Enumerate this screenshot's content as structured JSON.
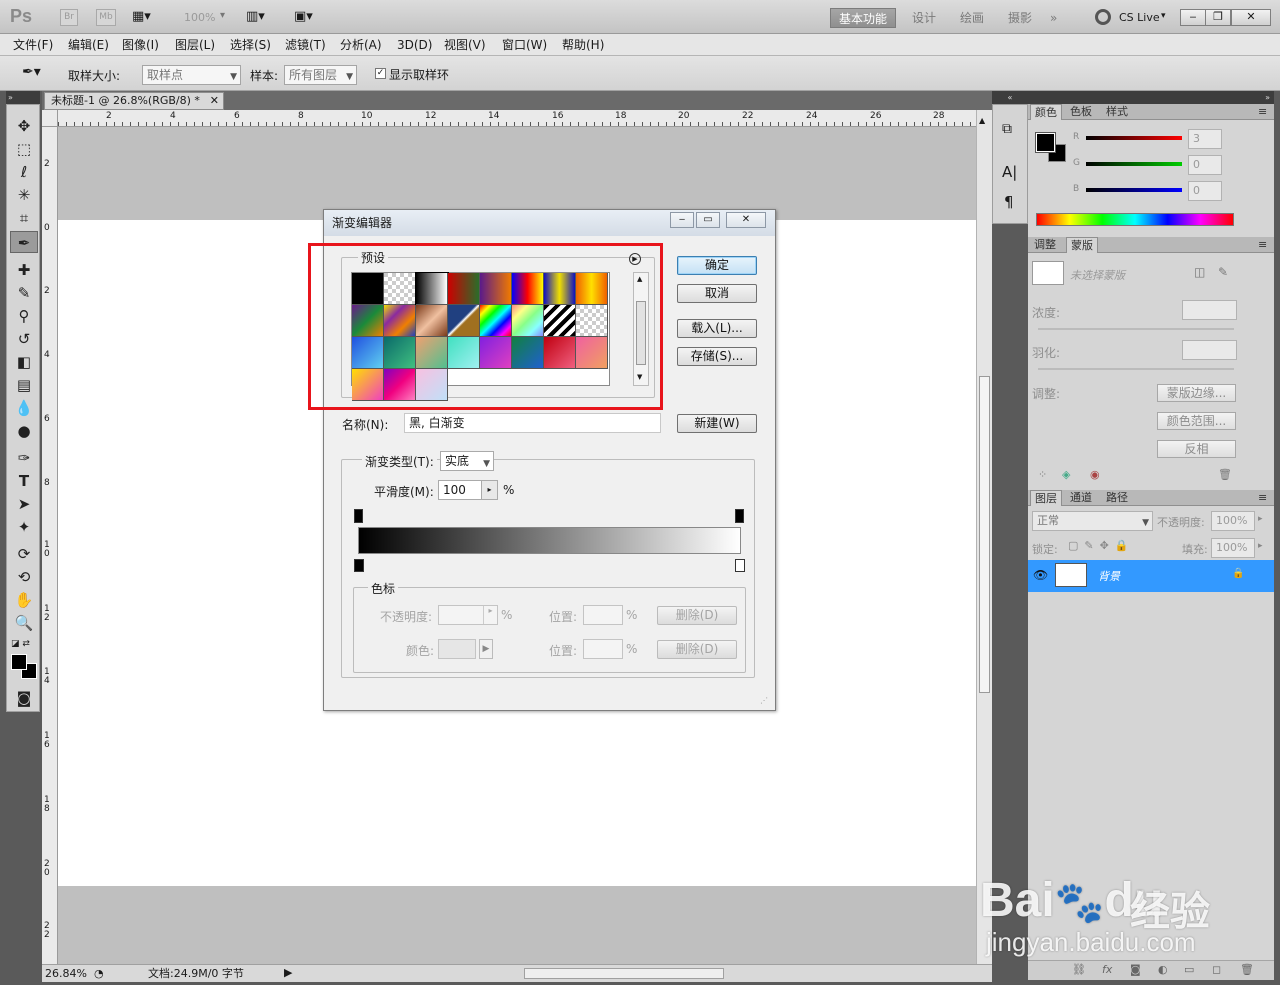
{
  "app": {
    "logo": "Ps",
    "br": "Br",
    "mb": "Mb",
    "zoom": "100%",
    "workspaces": [
      "基本功能",
      "设计",
      "绘画",
      "摄影",
      "»"
    ],
    "cs_live": "CS Live"
  },
  "menu": [
    "文件(F)",
    "编辑(E)",
    "图像(I)",
    "图层(L)",
    "选择(S)",
    "滤镜(T)",
    "分析(A)",
    "3D(D)",
    "视图(V)",
    "窗口(W)",
    "帮助(H)"
  ],
  "options": {
    "sample_size_label": "取样大小:",
    "sample_size_value": "取样点",
    "sample_label": "样本:",
    "sample_value": "所有图层",
    "show_ring_label": "显示取样环"
  },
  "document": {
    "tab_title": "未标题-1 @ 26.8%(RGB/8) *",
    "ruler_h": [
      "2",
      "4",
      "6",
      "8",
      "10",
      "12",
      "14",
      "16",
      "18",
      "20",
      "22",
      "24",
      "26",
      "28"
    ],
    "ruler_v": [
      "2",
      "0",
      "2",
      "4",
      "6",
      "8",
      "10",
      "12",
      "14",
      "16",
      "18",
      "20",
      "22"
    ],
    "zoom_status": "26.84%",
    "doc_status": "文档:24.9M/0 字节"
  },
  "dialog": {
    "title": "渐变编辑器",
    "presets_label": "预设",
    "ok": "确定",
    "cancel": "取消",
    "load": "载入(L)...",
    "save": "存储(S)...",
    "name_label": "名称(N):",
    "name_value": "黑, 白渐变",
    "new_button": "新建(W)",
    "type_label": "渐变类型(T):",
    "type_value": "实底",
    "smooth_label": "平滑度(M):",
    "smooth_value": "100",
    "percent": "%",
    "stops_label": "色标",
    "opacity_label": "不透明度:",
    "color_label": "颜色:",
    "position_label": "位置:",
    "delete_label": "删除(D)",
    "presets": [
      {
        "name": "foreground-to-background",
        "css": "linear-gradient(90deg,#000,#000)"
      },
      {
        "name": "foreground-to-transparent",
        "css": "repeating-conic-gradient(#fff 0 25%,#ccc 0 50%) 0 0/8px 8px"
      },
      {
        "name": "black-white",
        "css": "linear-gradient(90deg,#000,#fff)"
      },
      {
        "name": "red-green",
        "css": "linear-gradient(90deg,#c00,#2a6e2a)"
      },
      {
        "name": "violet-orange",
        "css": "linear-gradient(90deg,#5a1a8a,#f07a00)"
      },
      {
        "name": "blue-red-yellow",
        "css": "linear-gradient(90deg,#00f,#f00,#ff0)"
      },
      {
        "name": "blue-yellow-blue",
        "css": "linear-gradient(90deg,#1010c0,#f0e000,#1010c0)"
      },
      {
        "name": "orange-yellow-orange",
        "css": "linear-gradient(90deg,#f06000,#ffe000,#f06000)"
      },
      {
        "name": "violet-green-orange",
        "css": "linear-gradient(135deg,#6a1a8a,#1a8a3a,#f08000)"
      },
      {
        "name": "yellow-violet-orange-blue",
        "css": "linear-gradient(135deg,#f0e000,#8a2aa0,#f08000,#2040c0)"
      },
      {
        "name": "copper",
        "css": "linear-gradient(135deg,#7a3a1a,#f0c0a0,#7a3a1a)"
      },
      {
        "name": "chrome",
        "css": "linear-gradient(135deg,#204080 45%,#fff 50%,#a07020 55%)"
      },
      {
        "name": "spectrum",
        "css": "linear-gradient(135deg,#f00,#ff0,#0f0,#0ff,#00f,#f0f,#f00)"
      },
      {
        "name": "transparent-rainbow",
        "css": "linear-gradient(135deg,#f88,#ff8,#8f8,#8ff,#88f)"
      },
      {
        "name": "transparent-stripes",
        "css": "repeating-linear-gradient(135deg,#000 0 4px,#fff 4px 8px)"
      },
      {
        "name": "neutral-density",
        "css": "repeating-conic-gradient(#fff 0 25%,#ccc 0 50%) 0 0/8px 8px"
      },
      {
        "name": "blue-cyan",
        "css": "linear-gradient(135deg,#2050e0,#60d0f0)"
      },
      {
        "name": "teal-green",
        "css": "linear-gradient(135deg,#0a6a6a,#40c080)"
      },
      {
        "name": "peach-green",
        "css": "linear-gradient(135deg,#f0a070,#50c090)"
      },
      {
        "name": "cyan-aqua",
        "css": "linear-gradient(135deg,#40e0c0,#a0f0f0)"
      },
      {
        "name": "violet-magenta",
        "css": "linear-gradient(135deg,#8020e0,#e040c0)"
      },
      {
        "name": "green-blue",
        "css": "linear-gradient(135deg,#108040,#2060d0)"
      },
      {
        "name": "red-pink",
        "css": "linear-gradient(135deg,#c00010,#f06080)"
      },
      {
        "name": "pink-orange",
        "css": "linear-gradient(135deg,#f060a0,#f0a060)"
      },
      {
        "name": "yellow-pink",
        "css": "linear-gradient(135deg,#ffe000,#f040c0)"
      },
      {
        "name": "violet-pink-stripe",
        "css": "linear-gradient(135deg,#8000c0,#f00080,#ff80c0)"
      },
      {
        "name": "transparent-pastel",
        "css": "linear-gradient(135deg,#f8c0e0,#c0e0f8),repeating-conic-gradient(#fff 0 25%,#ccc 0 50%) 0 0/8px 8px"
      }
    ]
  },
  "panels": {
    "color_tabs": [
      "颜色",
      "色板",
      "样式"
    ],
    "channels": [
      {
        "label": "R",
        "value": "3",
        "color": "#ff0000"
      },
      {
        "label": "G",
        "value": "0",
        "color": "#00c000"
      },
      {
        "label": "B",
        "value": "0",
        "color": "#0000ff"
      }
    ],
    "adjust_tabs": [
      "调整",
      "蒙版"
    ],
    "mask_label": "未选择蒙版",
    "density_label": "浓度:",
    "feather_label": "羽化:",
    "refine_label": "调整:",
    "mask_edge": "蒙版边缘...",
    "color_range": "颜色范围...",
    "invert": "反相",
    "layers_tabs": [
      "图层",
      "通道",
      "路径"
    ],
    "blend_mode": "正常",
    "opacity_label": "不透明度:",
    "opacity_value": "100%",
    "lock_label": "锁定:",
    "fill_label": "填充:",
    "fill_value": "100%",
    "layer_name": "背景",
    "layer_highlight": "#3399ff"
  },
  "watermark": {
    "brand": "Bai",
    "brand2": "du",
    "cn": "经验",
    "url": "jingyan.baidu.com"
  }
}
